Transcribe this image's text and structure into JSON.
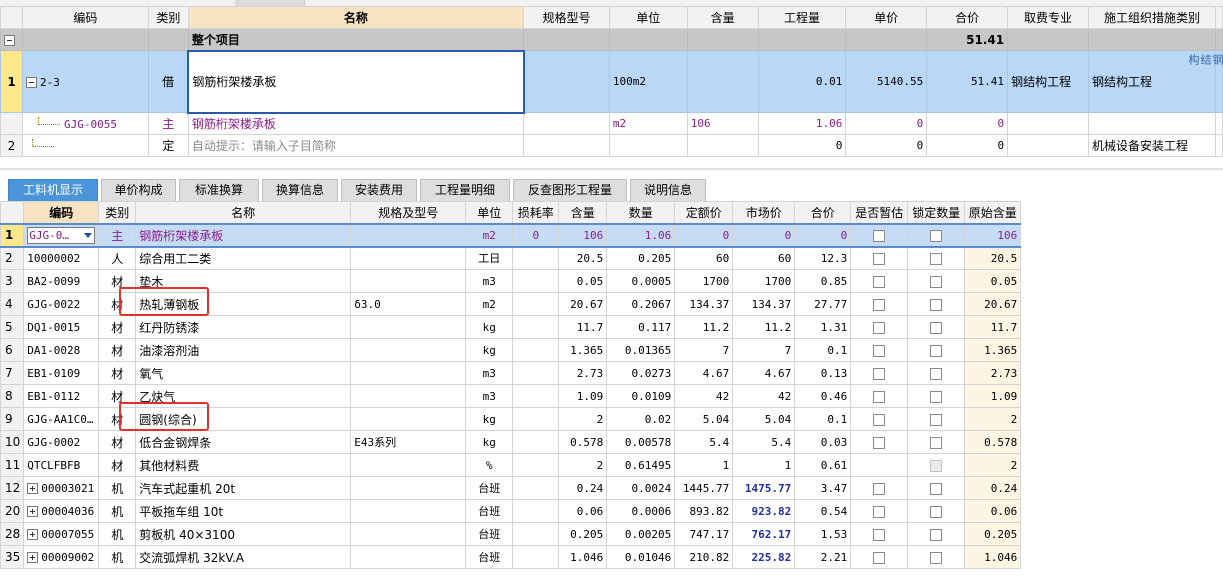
{
  "upper": {
    "headers": [
      "",
      "编码",
      "类别",
      "名称",
      "规格型号",
      "单位",
      "含量",
      "工程量",
      "单价",
      "合价",
      "取费专业",
      "施工组织措施类别"
    ],
    "project_row": {
      "name": "整个项目",
      "total": "51.41"
    },
    "item_row": {
      "no": "1",
      "code": "2-3",
      "type": "借",
      "name": "钢筋桁架楼承板",
      "unit": "100m2",
      "qty": "0.01",
      "price": "5140.55",
      "total": "51.41",
      "fee": "钢结构工程",
      "measure": "钢结构工程",
      "edge_text": "钢结构"
    },
    "sub_row": {
      "code": "GJG-0055",
      "type": "主",
      "name": "钢筋桁架楼承板",
      "unit": "m2",
      "content": "106",
      "qty": "1.06",
      "price": "0",
      "total": "0"
    },
    "define_row": {
      "no": "2",
      "type": "定",
      "name": "自动提示：请输入子目简称",
      "qty": "0",
      "price": "0",
      "total": "0",
      "measure": "机械设备安装工程"
    }
  },
  "tabs": [
    "工料机显示",
    "单价构成",
    "标准换算",
    "换算信息",
    "安装费用",
    "工程量明细",
    "反查图形工程量",
    "说明信息"
  ],
  "lower": {
    "headers": [
      "",
      "编码",
      "类别",
      "名称",
      "规格及型号",
      "单位",
      "损耗率",
      "含量",
      "数量",
      "定额价",
      "市场价",
      "合价",
      "是否暂估",
      "锁定数量",
      "原始含量"
    ],
    "rows": [
      {
        "no": "1",
        "code": "GJG-0…",
        "type": "主",
        "name": "钢筋桁架楼承板",
        "spec": "",
        "unit": "m2",
        "loss": "0",
        "content": "106",
        "qty": "1.06",
        "quota": "0",
        "market": "0",
        "total": "0",
        "orig": "106"
      },
      {
        "no": "2",
        "code": "10000002",
        "type": "人",
        "name": "综合用工二类",
        "spec": "",
        "unit": "工日",
        "loss": "",
        "content": "20.5",
        "qty": "0.205",
        "quota": "60",
        "market": "60",
        "total": "12.3",
        "orig": "20.5"
      },
      {
        "no": "3",
        "code": "BA2-0099",
        "type": "材",
        "name": "垫木",
        "spec": "",
        "unit": "m3",
        "loss": "",
        "content": "0.05",
        "qty": "0.0005",
        "quota": "1700",
        "market": "1700",
        "total": "0.85",
        "orig": "0.05"
      },
      {
        "no": "4",
        "code": "GJG-0022",
        "type": "材",
        "name": "热轧薄钢板",
        "spec": "δ3.0",
        "unit": "m2",
        "loss": "",
        "content": "20.67",
        "qty": "0.2067",
        "quota": "134.37",
        "market": "134.37",
        "total": "27.77",
        "orig": "20.67"
      },
      {
        "no": "5",
        "code": "DQ1-0015",
        "type": "材",
        "name": "红丹防锈漆",
        "spec": "",
        "unit": "kg",
        "loss": "",
        "content": "11.7",
        "qty": "0.117",
        "quota": "11.2",
        "market": "11.2",
        "total": "1.31",
        "orig": "11.7"
      },
      {
        "no": "6",
        "code": "DA1-0028",
        "type": "材",
        "name": "油漆溶剂油",
        "spec": "",
        "unit": "kg",
        "loss": "",
        "content": "1.365",
        "qty": "0.01365",
        "quota": "7",
        "market": "7",
        "total": "0.1",
        "orig": "1.365"
      },
      {
        "no": "7",
        "code": "EB1-0109",
        "type": "材",
        "name": "氧气",
        "spec": "",
        "unit": "m3",
        "loss": "",
        "content": "2.73",
        "qty": "0.0273",
        "quota": "4.67",
        "market": "4.67",
        "total": "0.13",
        "orig": "2.73"
      },
      {
        "no": "8",
        "code": "EB1-0112",
        "type": "材",
        "name": "乙炔气",
        "spec": "",
        "unit": "m3",
        "loss": "",
        "content": "1.09",
        "qty": "0.0109",
        "quota": "42",
        "market": "42",
        "total": "0.46",
        "orig": "1.09"
      },
      {
        "no": "9",
        "code": "GJG-AA1C0…",
        "type": "材",
        "name": "圆钢(综合)",
        "spec": "",
        "unit": "kg",
        "loss": "",
        "content": "2",
        "qty": "0.02",
        "quota": "5.04",
        "market": "5.04",
        "total": "0.1",
        "orig": "2"
      },
      {
        "no": "10",
        "code": "GJG-0002",
        "type": "材",
        "name": "低合金钢焊条",
        "spec": "E43系列",
        "unit": "kg",
        "loss": "",
        "content": "0.578",
        "qty": "0.00578",
        "quota": "5.4",
        "market": "5.4",
        "total": "0.03",
        "orig": "0.578"
      },
      {
        "no": "11",
        "code": "QTCLFBFB",
        "type": "材",
        "name": "其他材料费",
        "spec": "",
        "unit": "%",
        "loss": "",
        "content": "2",
        "qty": "0.61495",
        "quota": "1",
        "market": "1",
        "total": "0.61",
        "orig": "2"
      },
      {
        "no": "12",
        "code": "00003021",
        "type": "机",
        "name": "汽车式起重机 20t",
        "spec": "",
        "unit": "台班",
        "loss": "",
        "content": "0.24",
        "qty": "0.0024",
        "quota": "1445.77",
        "market": "1475.77",
        "total": "3.47",
        "orig": "0.24"
      },
      {
        "no": "20",
        "code": "00004036",
        "type": "机",
        "name": "平板拖车组 10t",
        "spec": "",
        "unit": "台班",
        "loss": "",
        "content": "0.06",
        "qty": "0.0006",
        "quota": "893.82",
        "market": "923.82",
        "total": "0.54",
        "orig": "0.06"
      },
      {
        "no": "28",
        "code": "00007055",
        "type": "机",
        "name": "剪板机 40×3100",
        "spec": "",
        "unit": "台班",
        "loss": "",
        "content": "0.205",
        "qty": "0.00205",
        "quota": "747.17",
        "market": "762.17",
        "total": "1.53",
        "orig": "0.205"
      },
      {
        "no": "35",
        "code": "00009002",
        "type": "机",
        "name": "交流弧焊机 32kV.A",
        "spec": "",
        "unit": "台班",
        "loss": "",
        "content": "1.046",
        "qty": "0.01046",
        "quota": "210.82",
        "market": "225.82",
        "total": "2.21",
        "orig": "1.046"
      }
    ]
  }
}
